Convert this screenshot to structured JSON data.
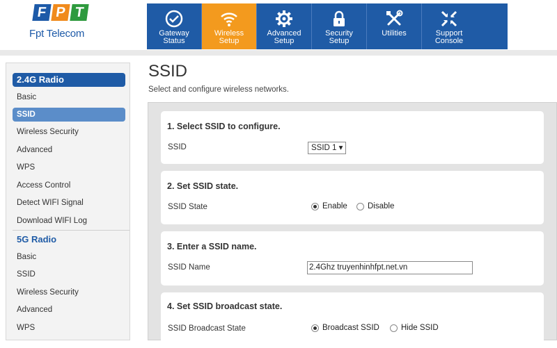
{
  "brand": {
    "tiles": [
      "F",
      "P",
      "T"
    ],
    "name": "Fpt Telecom",
    "colors": {
      "blue": "#1d5aa8",
      "orange": "#f08a1c",
      "green": "#2e9a3e"
    }
  },
  "nav": {
    "items": [
      {
        "line1": "Gateway",
        "line2": "Status",
        "icon": "check-circle-icon",
        "active": false
      },
      {
        "line1": "Wireless",
        "line2": "Setup",
        "icon": "wifi-icon",
        "active": true
      },
      {
        "line1": "Advanced",
        "line2": "Setup",
        "icon": "gear-icon",
        "active": false
      },
      {
        "line1": "Security",
        "line2": "Setup",
        "icon": "lock-icon",
        "active": false
      },
      {
        "line1": "Utilities",
        "line2": "",
        "icon": "tools-icon",
        "active": false
      },
      {
        "line1": "Support",
        "line2": "Console",
        "icon": "arrows-in-icon",
        "active": false
      }
    ],
    "colors": {
      "bar": "#1f5ba6",
      "active": "#f39a1e"
    }
  },
  "sidebar": {
    "sections": [
      {
        "title": "2.4G Radio",
        "items": [
          "Basic",
          "SSID",
          "Wireless Security",
          "Advanced",
          "WPS",
          "Access Control",
          "Detect WIFI Signal",
          "Download WIFI Log"
        ],
        "active_item": "SSID"
      },
      {
        "title": "5G Radio",
        "items": [
          "Basic",
          "SSID",
          "Wireless Security",
          "Advanced",
          "WPS"
        ],
        "active_item": ""
      }
    ]
  },
  "page": {
    "title": "SSID",
    "subtitle": "Select and configure wireless networks."
  },
  "sections": {
    "select": {
      "heading": "1. Select SSID to configure.",
      "label": "SSID",
      "value": "SSID 1 ▾"
    },
    "state": {
      "heading": "2. Set SSID state.",
      "label": "SSID State",
      "options": [
        "Enable",
        "Disable"
      ],
      "selected": "Enable"
    },
    "name": {
      "heading": "3. Enter a SSID name.",
      "label": "SSID Name",
      "value": "2.4Ghz truyenhinhfpt.net.vn"
    },
    "broadcast": {
      "heading": "4. Set SSID broadcast state.",
      "label": "SSID Broadcast State",
      "options": [
        "Broadcast SSID",
        "Hide SSID"
      ],
      "selected": "Broadcast SSID"
    }
  }
}
